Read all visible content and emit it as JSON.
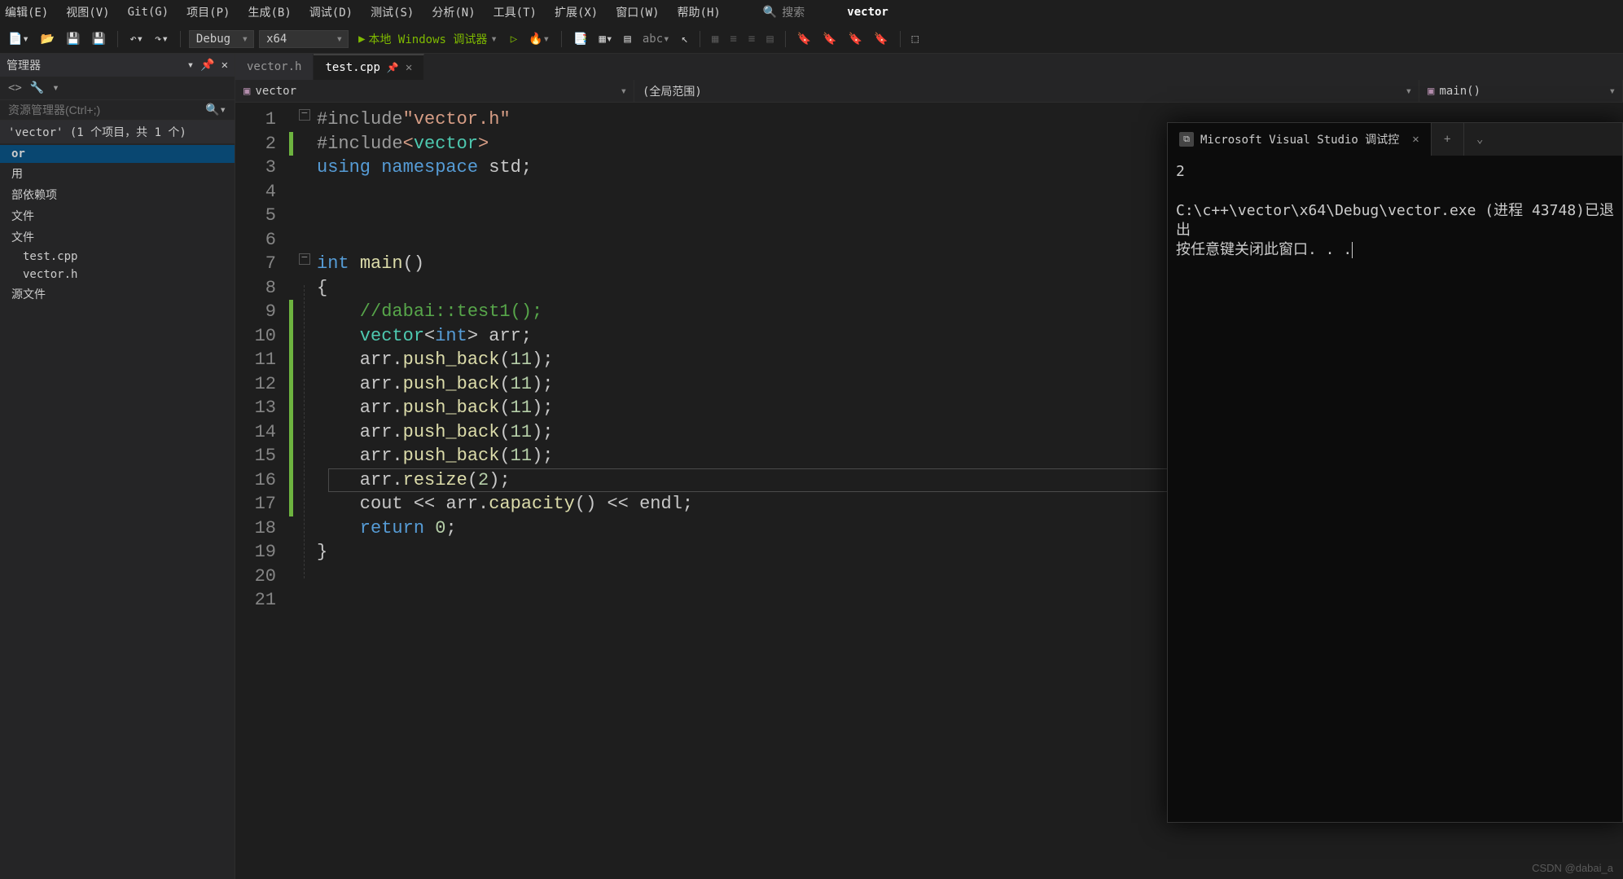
{
  "menu": {
    "items": [
      "编辑(E)",
      "视图(V)",
      "Git(G)",
      "项目(P)",
      "生成(B)",
      "调试(D)",
      "测试(S)",
      "分析(N)",
      "工具(T)",
      "扩展(X)",
      "窗口(W)",
      "帮助(H)"
    ],
    "searchLabel": "搜索",
    "searchTerm": "vector"
  },
  "toolbar": {
    "config": "Debug",
    "platform": "x64",
    "runLabel": "本地 Windows 调试器"
  },
  "sidebar": {
    "title": "管理器",
    "searchPlaceholder": "资源管理器(Ctrl+;)",
    "solution": "'vector' (1 个项目，共 1 个)",
    "projectName": "or",
    "items": [
      "用",
      "部依赖项",
      "文件",
      "文件"
    ],
    "files": [
      "test.cpp",
      "vector.h"
    ],
    "resourceGroup": "源文件"
  },
  "tabs": [
    {
      "label": "vector.h",
      "active": false
    },
    {
      "label": "test.cpp",
      "active": true
    }
  ],
  "crumbs": {
    "project": "vector",
    "scope": "(全局范围)",
    "func": "main()"
  },
  "code": {
    "lineCount": 21,
    "lines": [
      {
        "n": 1,
        "t": [
          [
            "pre",
            "#include"
          ],
          [
            "str",
            "\"vector.h\""
          ]
        ]
      },
      {
        "n": 2,
        "bar": true,
        "t": [
          [
            "pre",
            "#include"
          ],
          [
            "str",
            "<"
          ],
          [
            "type",
            "vector"
          ],
          [
            "str",
            ">"
          ]
        ]
      },
      {
        "n": 3,
        "t": [
          [
            "kw",
            "using "
          ],
          [
            "kw",
            "namespace "
          ],
          [
            "ns",
            "std"
          ],
          [
            "pun",
            ";"
          ]
        ]
      },
      {
        "n": 4,
        "t": []
      },
      {
        "n": 5,
        "t": []
      },
      {
        "n": 6,
        "t": []
      },
      {
        "n": 7,
        "fold": true,
        "t": [
          [
            "kw",
            "int "
          ],
          [
            "id",
            "main"
          ],
          [
            "pun",
            "()"
          ]
        ]
      },
      {
        "n": 8,
        "t": [
          [
            "pun",
            "{"
          ]
        ]
      },
      {
        "n": 9,
        "bar": true,
        "t": [
          [
            "com",
            "    //dabai::test1();"
          ]
        ]
      },
      {
        "n": 10,
        "bar": true,
        "t": [
          [
            "type",
            "    vector"
          ],
          [
            "pun",
            "<"
          ],
          [
            "kw",
            "int"
          ],
          [
            "pun",
            "> "
          ],
          [
            "var",
            "arr"
          ],
          [
            "pun",
            ";"
          ]
        ]
      },
      {
        "n": 11,
        "bar": true,
        "t": [
          [
            "var",
            "    arr"
          ],
          [
            "pun",
            "."
          ],
          [
            "id",
            "push_back"
          ],
          [
            "pun",
            "("
          ],
          [
            "num",
            "11"
          ],
          [
            "pun",
            ");"
          ]
        ]
      },
      {
        "n": 12,
        "bar": true,
        "t": [
          [
            "var",
            "    arr"
          ],
          [
            "pun",
            "."
          ],
          [
            "id",
            "push_back"
          ],
          [
            "pun",
            "("
          ],
          [
            "num",
            "11"
          ],
          [
            "pun",
            ");"
          ]
        ]
      },
      {
        "n": 13,
        "bar": true,
        "t": [
          [
            "var",
            "    arr"
          ],
          [
            "pun",
            "."
          ],
          [
            "id",
            "push_back"
          ],
          [
            "pun",
            "("
          ],
          [
            "num",
            "11"
          ],
          [
            "pun",
            ");"
          ]
        ]
      },
      {
        "n": 14,
        "bar": true,
        "t": [
          [
            "var",
            "    arr"
          ],
          [
            "pun",
            "."
          ],
          [
            "id",
            "push_back"
          ],
          [
            "pun",
            "("
          ],
          [
            "num",
            "11"
          ],
          [
            "pun",
            ");"
          ]
        ]
      },
      {
        "n": 15,
        "bar": true,
        "t": [
          [
            "var",
            "    arr"
          ],
          [
            "pun",
            "."
          ],
          [
            "id",
            "push_back"
          ],
          [
            "pun",
            "("
          ],
          [
            "num",
            "11"
          ],
          [
            "pun",
            ");"
          ]
        ]
      },
      {
        "n": 16,
        "bar": true,
        "hl": true,
        "t": [
          [
            "var",
            "    arr"
          ],
          [
            "pun",
            "."
          ],
          [
            "id",
            "resize"
          ],
          [
            "pun",
            "("
          ],
          [
            "num",
            "2"
          ],
          [
            "pun",
            ");"
          ]
        ]
      },
      {
        "n": 17,
        "bar": true,
        "t": [
          [
            "var",
            "    cout"
          ],
          [
            "pun",
            " << "
          ],
          [
            "var",
            "arr"
          ],
          [
            "pun",
            "."
          ],
          [
            "id",
            "capacity"
          ],
          [
            "pun",
            "() << "
          ],
          [
            "var",
            "endl"
          ],
          [
            "pun",
            ";"
          ]
        ]
      },
      {
        "n": 18,
        "t": [
          [
            "kw",
            "    return "
          ],
          [
            "num",
            "0"
          ],
          [
            "pun",
            ";"
          ]
        ]
      },
      {
        "n": 19,
        "t": [
          [
            "pun",
            "}"
          ]
        ]
      },
      {
        "n": 20,
        "t": []
      },
      {
        "n": 21,
        "t": []
      }
    ]
  },
  "console": {
    "tabTitle": "Microsoft Visual Studio 调试控",
    "output": "2",
    "line2": "C:\\c++\\vector\\x64\\Debug\\vector.exe (进程 43748)已退出",
    "line3": "按任意键关闭此窗口. . ."
  },
  "watermark": "CSDN @dabai_a"
}
